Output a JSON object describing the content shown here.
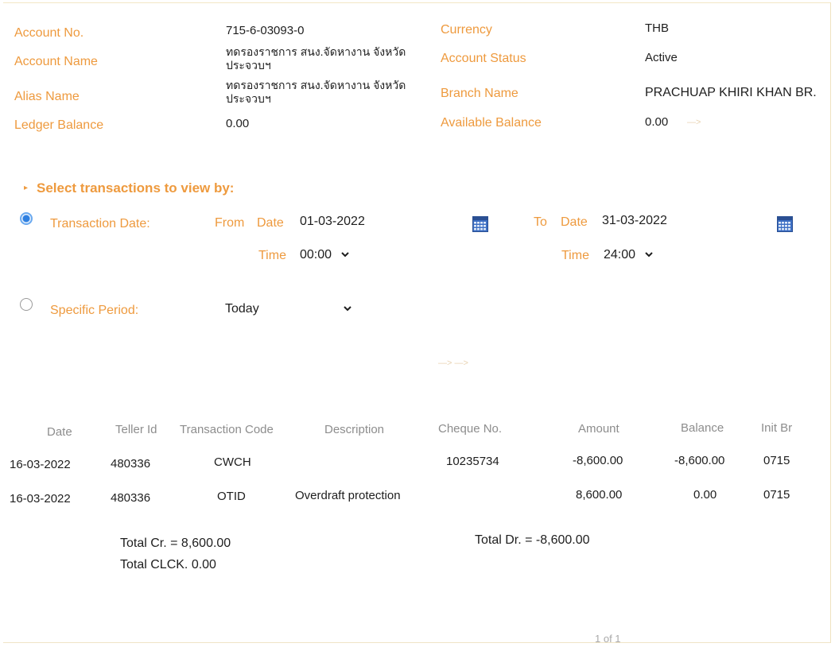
{
  "account": {
    "account_no_label": "Account No.",
    "account_no": "715-6-03093-0",
    "account_name_label": "Account Name",
    "account_name": "ทดรองราชการ สนง.จัดหางาน จังหวัดประจวบฯ",
    "alias_name_label": "Alias Name",
    "alias_name": "ทดรองราชการ สนง.จัดหางาน จังหวัดประจวบฯ",
    "ledger_balance_label": "Ledger Balance",
    "ledger_balance": "0.00",
    "currency_label": "Currency",
    "currency": "THB",
    "status_label": "Account Status",
    "status": "Active",
    "branch_label": "Branch Name",
    "branch": "PRACHUAP KHIRI KHAN BR.",
    "available_balance_label": "Available Balance",
    "available_balance": "0.00"
  },
  "filter": {
    "title": "Select transactions to view by:",
    "transaction_date_label": "Transaction Date:",
    "from_label": "From",
    "date_label": "Date",
    "from_date": "01-03-2022",
    "time_label": "Time",
    "from_time": "00:00",
    "to_label": "To",
    "to_date": "31-03-2022",
    "to_time": "24:00",
    "specific_period_label": "Specific Period:",
    "specific_period": "Today"
  },
  "table": {
    "headers": {
      "date": "Date",
      "teller": "Teller Id",
      "code": "Transaction Code",
      "description": "Description",
      "cheque": "Cheque No.",
      "amount": "Amount",
      "balance": "Balance",
      "init_br": "Init Br"
    },
    "rows": [
      {
        "date": "16-03-2022",
        "teller": "480336",
        "code": "CWCH",
        "description": "",
        "cheque": "10235734",
        "amount": "-8,600.00",
        "balance": "-8,600.00",
        "init_br": "0715"
      },
      {
        "date": "16-03-2022",
        "teller": "480336",
        "code": "OTID",
        "description": "Overdraft protection",
        "cheque": "",
        "amount": "8,600.00",
        "balance": "0.00",
        "init_br": "0715"
      }
    ]
  },
  "totals": {
    "total_cr": "Total Cr. = 8,600.00",
    "total_clck": "Total CLCK.  0.00",
    "total_dr": "Total Dr. = -8,600.00"
  },
  "pager": {
    "text": "1 of 1"
  },
  "colors": {
    "label": "#ee9a3e",
    "radio_selected": "#2e7fe0",
    "header_text": "#8d8d8d"
  },
  "icons": {
    "calendar": "calendar-icon",
    "chevron": "chevron-down-icon",
    "radio": "radio-icon"
  }
}
